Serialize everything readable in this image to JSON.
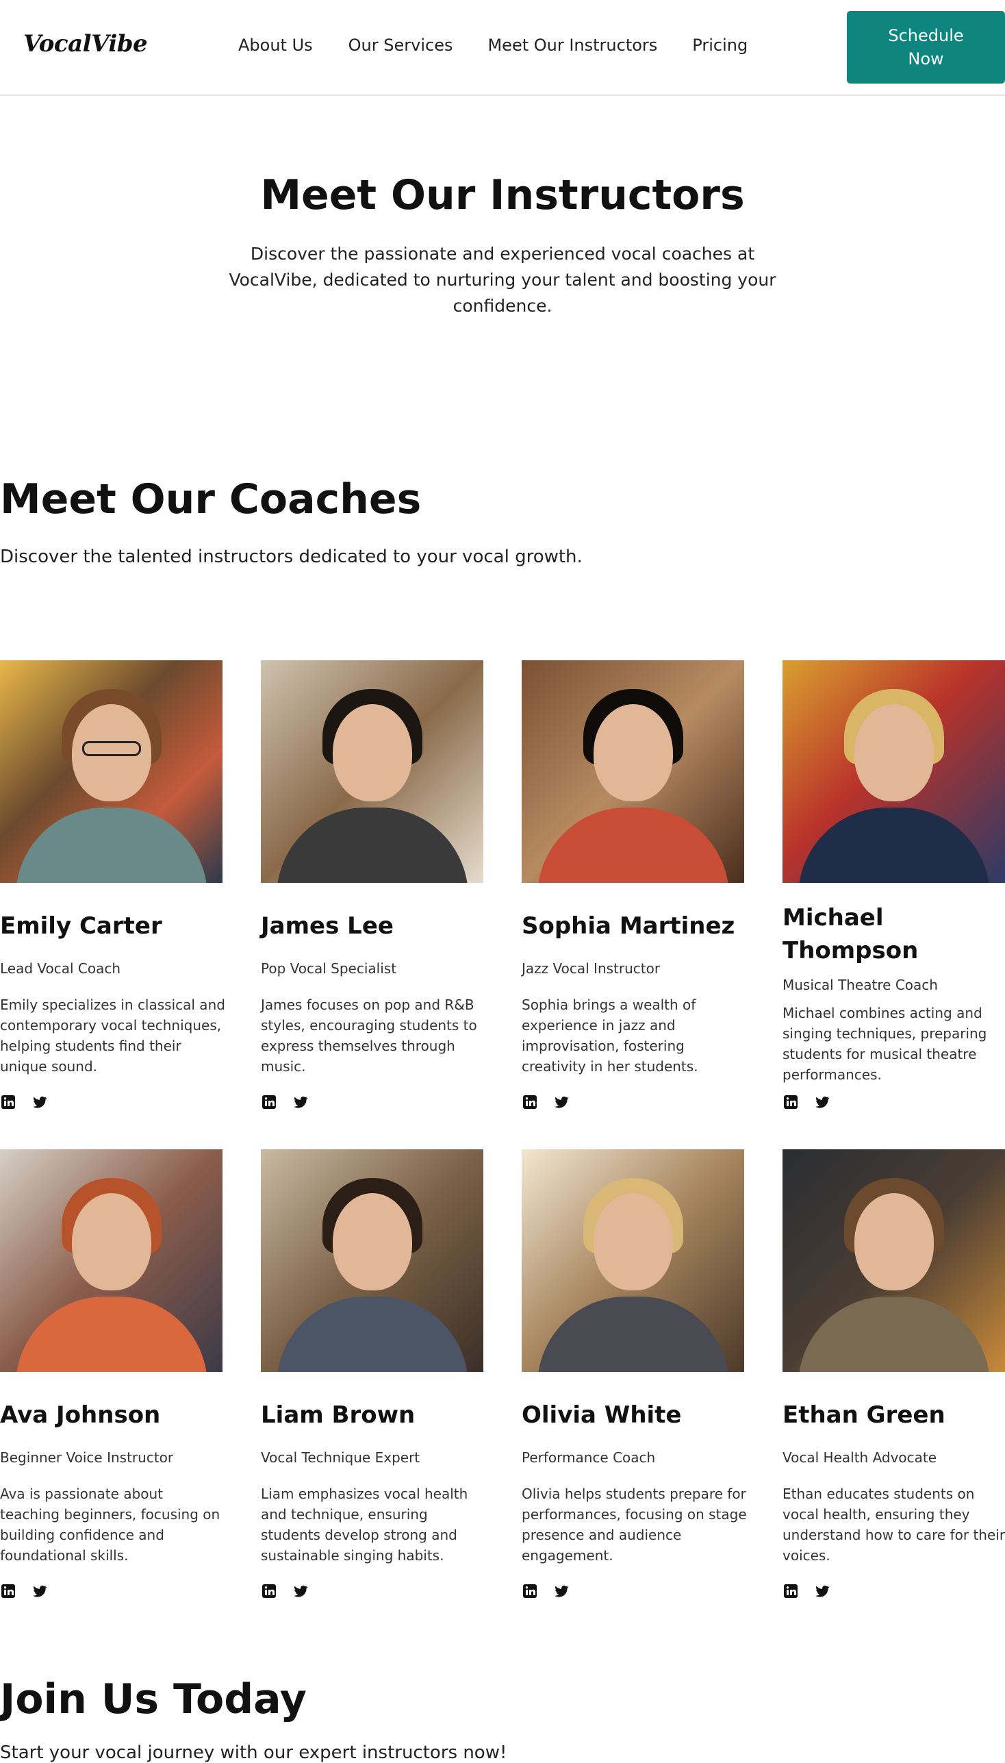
{
  "header": {
    "logo": "VocalVibe",
    "nav": [
      "About Us",
      "Our Services",
      "Meet Our Instructors",
      "Pricing"
    ],
    "cta_label": "Schedule Now"
  },
  "hero": {
    "title": "Meet Our Instructors",
    "subtitle": "Discover the passionate and experienced vocal coaches at VocalVibe, dedicated to nurturing your talent and boosting your confidence."
  },
  "coaches_section": {
    "title": "Meet Our Coaches",
    "subtitle": "Discover the talented instructors dedicated to your vocal growth."
  },
  "coaches": [
    {
      "name": "Emily Carter",
      "role": "Lead Vocal Coach",
      "desc": "Emily specializes in classical and contemporary vocal techniques, helping students find their unique sound."
    },
    {
      "name": "James Lee",
      "role": "Pop Vocal Specialist",
      "desc": "James focuses on pop and R&B styles, encouraging students to express themselves through music."
    },
    {
      "name": "Sophia Martinez",
      "role": "Jazz Vocal Instructor",
      "desc": "Sophia brings a wealth of experience in jazz and improvisation, fostering creativity in her students."
    },
    {
      "name": "Michael Thompson",
      "role": "Musical Theatre Coach",
      "desc": "Michael combines acting and singing techniques, preparing students for musical theatre performances."
    },
    {
      "name": "Ava Johnson",
      "role": "Beginner Voice Instructor",
      "desc": "Ava is passionate about teaching beginners, focusing on building confidence and foundational skills."
    },
    {
      "name": "Liam Brown",
      "role": "Vocal Technique Expert",
      "desc": "Liam emphasizes vocal health and technique, ensuring students develop strong and sustainable singing habits."
    },
    {
      "name": "Olivia White",
      "role": "Performance Coach",
      "desc": "Olivia helps students prepare for performances, focusing on stage presence and audience engagement."
    },
    {
      "name": "Ethan Green",
      "role": "Vocal Health Advocate",
      "desc": "Ethan educates students on vocal health, ensuring they understand how to care for their voices."
    }
  ],
  "social_icons": [
    "linkedin-icon",
    "twitter-icon"
  ],
  "join": {
    "title": "Join Us Today",
    "subtitle": "Start your vocal journey with our expert instructors now!"
  },
  "colors": {
    "accent": "#0e857f",
    "text": "#111111"
  }
}
